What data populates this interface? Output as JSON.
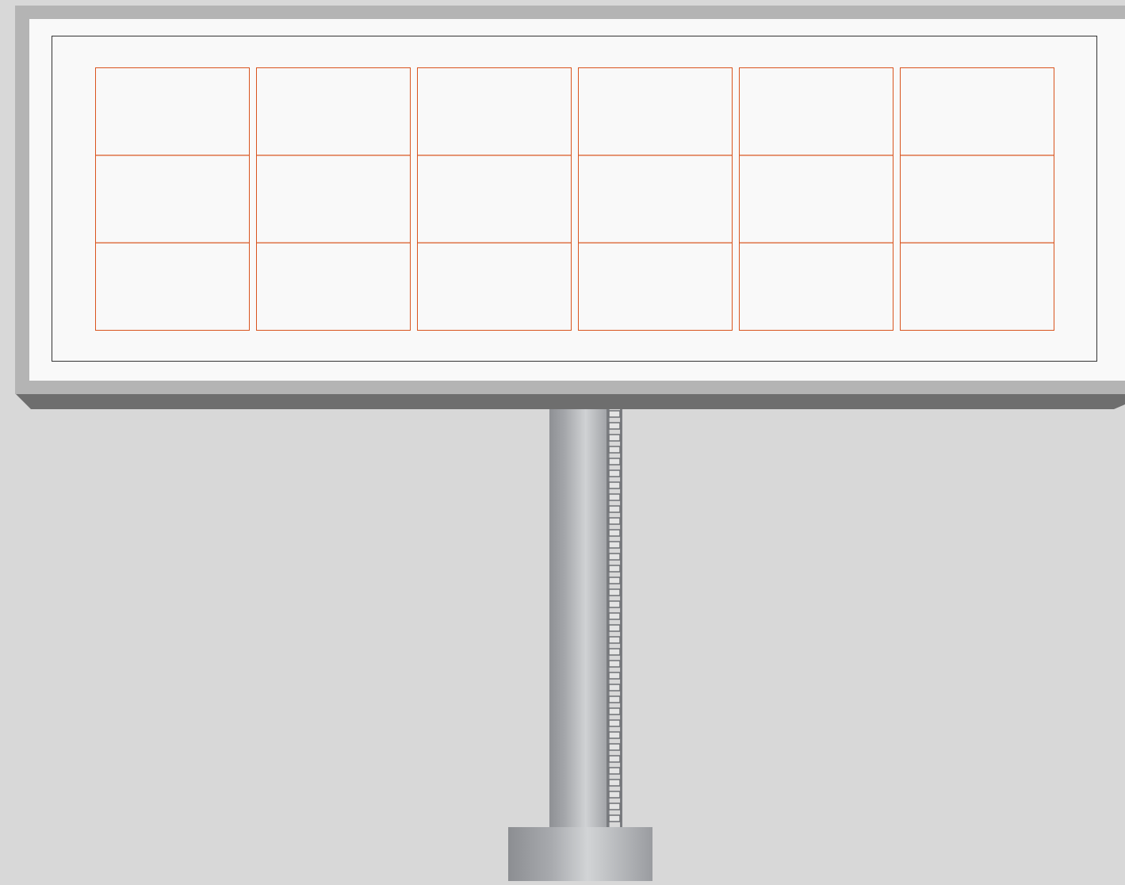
{
  "colors": {
    "background": "#d8d8d8",
    "frame": "#b4b4b4",
    "frame_shadow": "#6e6e6e",
    "panel": "#f9f9f9",
    "panel_border": "#333333",
    "grid_line": "#d9541e",
    "pole_dark": "#8e9094",
    "pole_light": "#d0d2d4"
  },
  "billboard": {
    "grid": {
      "rows": 3,
      "columns": 6
    }
  },
  "pole": {
    "ladder_rungs": 35
  }
}
